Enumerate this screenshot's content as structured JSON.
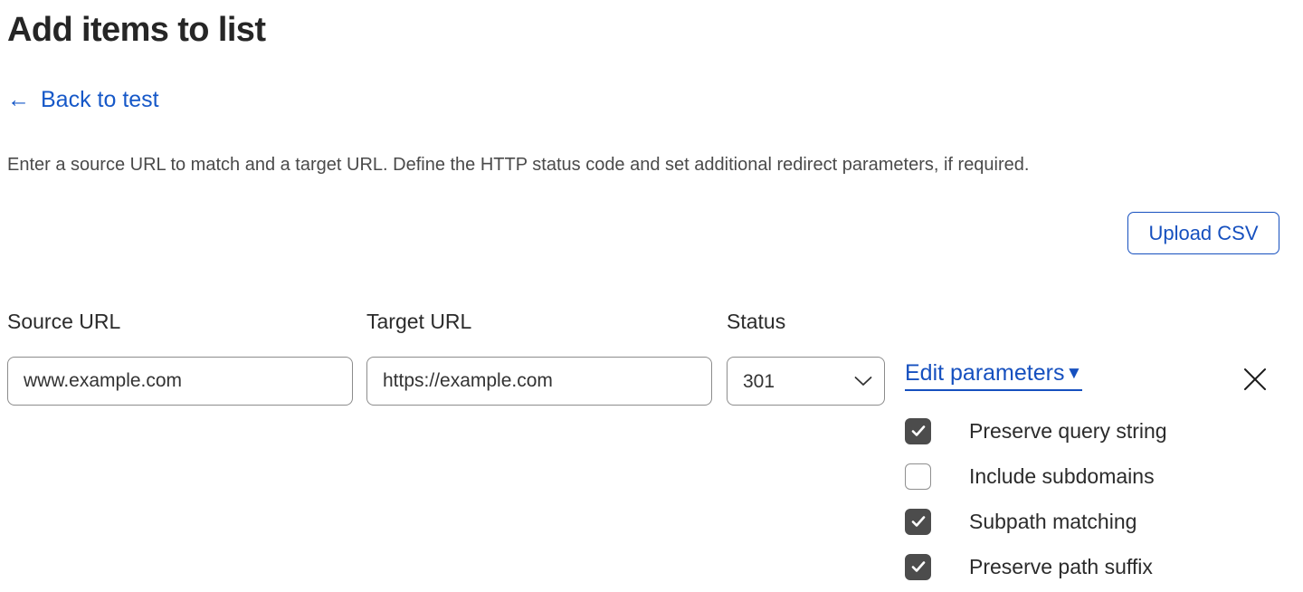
{
  "page": {
    "title": "Add items to list",
    "back_link": {
      "label": "Back to test",
      "arrow_glyph": "←",
      "icon": "arrow-left-icon"
    },
    "description": "Enter a source URL to match and a target URL. Define the HTTP status code and set additional redirect parameters, if required.",
    "upload_csv_label": "Upload CSV"
  },
  "columns": {
    "source_label": "Source URL",
    "target_label": "Target URL",
    "status_label": "Status"
  },
  "row": {
    "source_url": "www.example.com",
    "source_placeholder": "www.example.com",
    "target_url": "https://example.com",
    "target_placeholder": "https://example.com",
    "status_value": "301",
    "status_options": [
      "301"
    ],
    "edit_parameters_label": "Edit parameters",
    "edit_parameters_caret": "▼",
    "remove_icon": "close-icon"
  },
  "parameters": [
    {
      "label": "Preserve query string",
      "checked": true
    },
    {
      "label": "Include subdomains",
      "checked": false
    },
    {
      "label": "Subpath matching",
      "checked": true
    },
    {
      "label": "Preserve path suffix",
      "checked": true
    }
  ],
  "colors": {
    "link_blue": "#1650bf",
    "text_dark": "#2b2b2b",
    "description_gray": "#4a4a4a",
    "checkbox_checked": "#4c4c4c",
    "border_gray": "#8c8c8c",
    "background": "#ffffff"
  }
}
